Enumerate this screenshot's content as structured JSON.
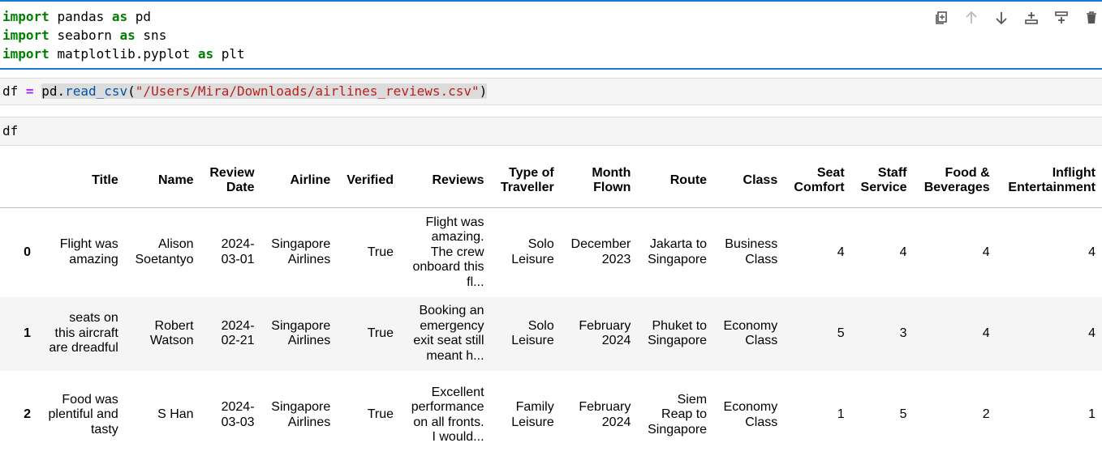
{
  "cell1": {
    "lines": [
      {
        "kw": "import",
        "mod": "pandas",
        "as": "as",
        "alias": "pd"
      },
      {
        "kw": "import",
        "mod": "seaborn",
        "as": "as",
        "alias": "sns"
      },
      {
        "kw": "import",
        "mod": "matplotlib.pyplot",
        "as": "as",
        "alias": "plt"
      }
    ]
  },
  "toolbar": {
    "icons": [
      "duplicate-icon",
      "move-up-icon",
      "move-down-icon",
      "insert-below-icon",
      "insert-above-icon",
      "delete-icon"
    ]
  },
  "cell2": {
    "var": "df",
    "eq": "=",
    "mod": "pd",
    "dot": ".",
    "fn": "read_csv",
    "open": "(",
    "arg": "\"/Users/Mira/Downloads/airlines_reviews.csv\"",
    "close": ")"
  },
  "cell3": {
    "code": "df"
  },
  "table": {
    "headers": [
      [
        "Title"
      ],
      [
        "Name"
      ],
      [
        "Review",
        "Date"
      ],
      [
        "Airline"
      ],
      [
        "Verified"
      ],
      [
        "Reviews"
      ],
      [
        "Type of",
        "Traveller"
      ],
      [
        "Month",
        "Flown"
      ],
      [
        "Route"
      ],
      [
        "Class"
      ],
      [
        "Seat",
        "Comfort"
      ],
      [
        "Staff",
        "Service"
      ],
      [
        "Food &",
        "Beverages"
      ],
      [
        "Inflight",
        "Entertainment"
      ]
    ],
    "rows": [
      {
        "index": "0",
        "cells": [
          [
            "Flight was",
            "amazing"
          ],
          [
            "Alison",
            "Soetantyo"
          ],
          [
            "2024-",
            "03-01"
          ],
          [
            "Singapore",
            "Airlines"
          ],
          [
            "True"
          ],
          [
            "Flight was",
            "amazing.",
            "The crew",
            "onboard this",
            "fl..."
          ],
          [
            "Solo",
            "Leisure"
          ],
          [
            "December",
            "2023"
          ],
          [
            "Jakarta to",
            "Singapore"
          ],
          [
            "Business",
            "Class"
          ],
          [
            "4"
          ],
          [
            "4"
          ],
          [
            "4"
          ],
          [
            "4"
          ]
        ]
      },
      {
        "index": "1",
        "cells": [
          [
            "seats on",
            "this aircraft",
            "are dreadful"
          ],
          [
            "Robert",
            "Watson"
          ],
          [
            "2024-",
            "02-21"
          ],
          [
            "Singapore",
            "Airlines"
          ],
          [
            "True"
          ],
          [
            "Booking an",
            "emergency",
            "exit seat still",
            "meant h..."
          ],
          [
            "Solo",
            "Leisure"
          ],
          [
            "February",
            "2024"
          ],
          [
            "Phuket to",
            "Singapore"
          ],
          [
            "Economy",
            "Class"
          ],
          [
            "5"
          ],
          [
            "3"
          ],
          [
            "4"
          ],
          [
            "4"
          ]
        ]
      },
      {
        "index": "2",
        "cells": [
          [
            "Food was",
            "plentiful and",
            "tasty"
          ],
          [
            "S Han"
          ],
          [
            "2024-",
            "03-03"
          ],
          [
            "Singapore",
            "Airlines"
          ],
          [
            "True"
          ],
          [
            "Excellent",
            "performance",
            "on all fronts.",
            "I would..."
          ],
          [
            "Family",
            "Leisure"
          ],
          [
            "February",
            "2024"
          ],
          [
            "Siem",
            "Reap to",
            "Singapore"
          ],
          [
            "Economy",
            "Class"
          ],
          [
            "1"
          ],
          [
            "5"
          ],
          [
            "2"
          ],
          [
            "1"
          ]
        ]
      }
    ]
  }
}
